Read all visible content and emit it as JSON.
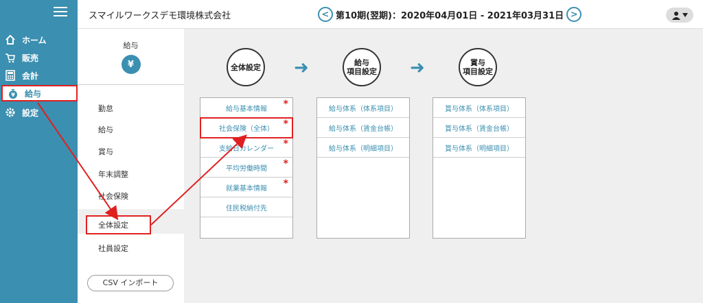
{
  "header": {
    "company": "スマイルワークスデモ環境株式会社",
    "period": "第10期(翌期)：2020年04月01日 - 2021年03月31日",
    "prev_label": "<",
    "next_label": ">",
    "user_icon": "user-icon"
  },
  "sidebar": {
    "items": [
      {
        "label": "ホーム",
        "icon": "home-icon"
      },
      {
        "label": "販売",
        "icon": "cart-icon"
      },
      {
        "label": "会計",
        "icon": "calculator-icon"
      },
      {
        "label": "給与",
        "icon": "money-bag-icon"
      },
      {
        "label": "設定",
        "icon": "gear-icon"
      }
    ]
  },
  "submenu": {
    "title": "給与",
    "bag_symbol": "¥",
    "items": [
      "勤怠",
      "給与",
      "賞与",
      "年末調整",
      "社会保険",
      "全体設定",
      "社員設定"
    ],
    "csv_label": "CSV インポート"
  },
  "flow": {
    "steps": [
      "全体設定",
      "給与\n項目設定",
      "賞与\n項目設定"
    ],
    "columns": [
      [
        {
          "label": "給与基本情報",
          "required": true
        },
        {
          "label": "社会保険（全体）",
          "required": true
        },
        {
          "label": "支給日カレンダー",
          "required": true
        },
        {
          "label": "平均労働時間",
          "required": true
        },
        {
          "label": "就業基本情報",
          "required": true
        },
        {
          "label": "住民税納付先",
          "required": false
        }
      ],
      [
        {
          "label": "給与体系（体系項目）",
          "required": false
        },
        {
          "label": "給与体系（賃金台帳）",
          "required": false
        },
        {
          "label": "給与体系（明細項目）",
          "required": false
        }
      ],
      [
        {
          "label": "賞与体系（体系項目）",
          "required": false
        },
        {
          "label": "賞与体系（賃金台帳）",
          "required": false
        },
        {
          "label": "賞与体系（明細項目）",
          "required": false
        }
      ]
    ],
    "required_mark": "*"
  },
  "colors": {
    "accent": "#3b8fb0",
    "highlight": "#e02020"
  }
}
